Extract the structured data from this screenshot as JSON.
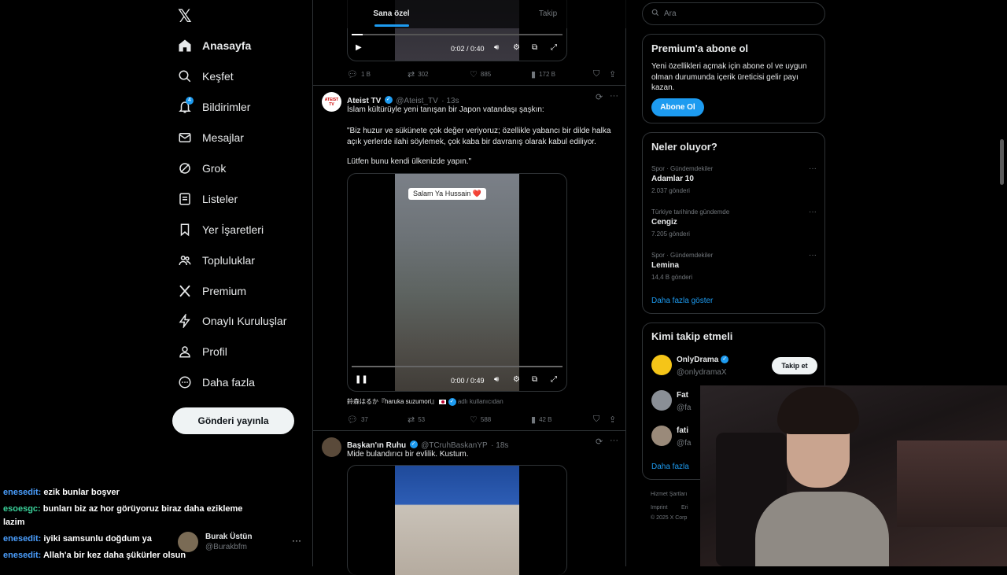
{
  "nav": {
    "logo": "𝕏",
    "items": [
      {
        "label": "Anasayfa",
        "icon": "home-icon",
        "active": true
      },
      {
        "label": "Keşfet",
        "icon": "search-icon"
      },
      {
        "label": "Bildirimler",
        "icon": "bell-icon",
        "badge": "4"
      },
      {
        "label": "Mesajlar",
        "icon": "mail-icon"
      },
      {
        "label": "Grok",
        "icon": "grok-icon"
      },
      {
        "label": "Listeler",
        "icon": "list-icon"
      },
      {
        "label": "Yer İşaretleri",
        "icon": "bookmark-icon"
      },
      {
        "label": "Topluluklar",
        "icon": "communities-icon"
      },
      {
        "label": "Premium",
        "icon": "x-icon"
      },
      {
        "label": "Onaylı Kuruluşlar",
        "icon": "lightning-icon"
      },
      {
        "label": "Profil",
        "icon": "person-icon"
      },
      {
        "label": "Daha fazla",
        "icon": "more-circle-icon"
      }
    ],
    "post_button": "Gönderi yayınla",
    "account": {
      "name": "Burak Üstün",
      "handle": "@Burakbfm",
      "more": "···"
    }
  },
  "chat": [
    {
      "user": "enesedit:",
      "text": "ezik bunlar boşver",
      "color": "#4b9fff"
    },
    {
      "user": "esoesgc:",
      "text": "bunları biz az hor görüyoruz biraz daha ezikleme",
      "text2": "lazim",
      "color": "#3ad19a"
    },
    {
      "user": "enesedit:",
      "text": "iyiki samsunlu doğdum ya",
      "color": "#4b9fff"
    },
    {
      "user": "enesedit:",
      "text": "Allah'a bir kez daha şükürler olsun",
      "color": "#4b9fff"
    }
  ],
  "feed": {
    "tabs": [
      {
        "label": "Sana özel",
        "active": true
      },
      {
        "label": "Takip"
      }
    ],
    "post0": {
      "video_time": "0:02 / 0:40",
      "actions": {
        "replies": "1 B",
        "reposts": "302",
        "likes": "885",
        "views": "172 B"
      }
    },
    "post1": {
      "name": "Ateist TV",
      "avatar_text": "ATEIST TV",
      "handle": "@Ateist_TV",
      "time": "· 13s",
      "text1": "İslam kültürüyle yeni tanışan bir Japon vatandaşı şaşkın:",
      "text2": "\"Biz huzur ve sükünete çok değer veriyoruz; özellikle yabancı bir dilde halka açık yerlerde ilahi söylemek, çok kaba bir davranış olarak kabul ediliyor.",
      "text3": "Lütfen bunu kendi ülkenizde yapın.\"",
      "video_caption": "Salam Ya Hussain ❤️",
      "video_time": "0:00 / 0:49",
      "credit_name": "鈴森はるか『haruka suzumori』",
      "credit_suffix": "adlı kullanıcıdan",
      "actions": {
        "replies": "37",
        "reposts": "53",
        "likes": "588",
        "views": "42 B"
      }
    },
    "post2": {
      "name": "Başkan'ın Ruhu",
      "handle": "@TCruhBaskanYP",
      "time": "· 18s",
      "text": "Mide bulandırıcı bir evlilik.  Kustum."
    }
  },
  "right": {
    "search_placeholder": "Ara",
    "premium": {
      "title": "Premium'a abone ol",
      "desc": "Yeni özellikleri açmak için abone ol ve uygun olman durumunda içerik üreticisi gelir payı kazan.",
      "button": "Abone Ol"
    },
    "trends": {
      "title": "Neler oluyor?",
      "items": [
        {
          "category": "Spor · Gündemdekiler",
          "name": "Adamlar 10",
          "count": "2.037 gönderi"
        },
        {
          "category": "Türkiye tarihinde gündemde",
          "name": "Cengiz",
          "count": "7.205 gönderi"
        },
        {
          "category": "Spor · Gündemdekiler",
          "name": "Lemina",
          "count": "14,4 B gönderi"
        }
      ],
      "more": "Daha fazla göster"
    },
    "who_to_follow": {
      "title": "Kimi takip etmeli",
      "items": [
        {
          "name": "OnlyDrama",
          "handle": "@onlydramaX",
          "button": "Takip et"
        },
        {
          "name": "Fat",
          "handle": "@fa"
        },
        {
          "name": "fati",
          "handle": "@fa"
        }
      ],
      "more": "Daha fazla"
    },
    "footer": [
      "Hizmet Şartları",
      "Imprint",
      "Eri",
      "© 2025 X Corp"
    ]
  },
  "colors": {
    "accent": "#1d9bf0",
    "background": "#000000",
    "text": "#e7e9ea",
    "muted": "#71767b",
    "border": "#2f3336"
  }
}
